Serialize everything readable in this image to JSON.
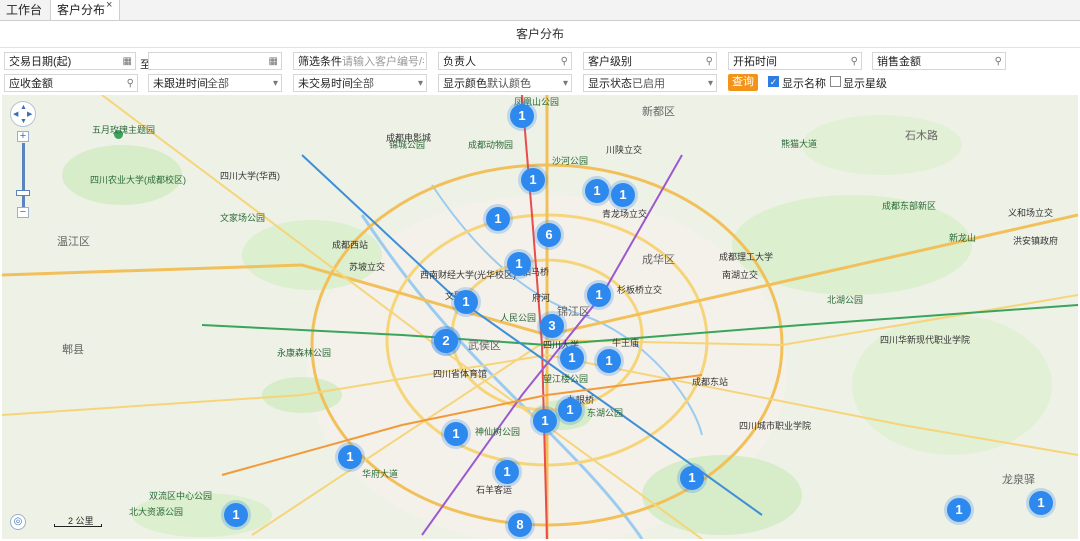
{
  "tabs": {
    "workbench": "工作台",
    "customer_dist": "客户分布",
    "close": "×"
  },
  "page_title": "客户分布",
  "filters": {
    "trade_date_start": "交易日期(起)",
    "to": "至",
    "screen_cond": "筛选条件",
    "screen_placeholder": "请输入客户编号/名",
    "owner": "负责人",
    "level": "客户级别",
    "open_time": "开拓时间",
    "sales_amount": "销售金额",
    "receivable": "应收金额",
    "no_follow_time": "未跟进时间",
    "no_follow_val": "全部",
    "no_trade_time": "未交易时间",
    "no_trade_val": "全部",
    "color_label": "显示颜色",
    "color_val": "默认颜色",
    "status_label": "显示状态",
    "status_val": "已启用",
    "query": "查询",
    "show_name": "显示名称",
    "show_star": "显示星级"
  },
  "map": {
    "scale": "2 公里",
    "markers": [
      "1",
      "1",
      "1",
      "1",
      "1",
      "1",
      "6",
      "1",
      "1",
      "1",
      "3",
      "2",
      "1",
      "1",
      "1",
      "1",
      "1",
      "1",
      "1",
      "1",
      "8",
      "1",
      "1"
    ],
    "districts": [
      "温江区",
      "锦江区",
      "武侯区",
      "成华区",
      "郫县",
      "新都区"
    ],
    "places": [
      "五月玫瑰主题园",
      "四川农业大学(成都校区)",
      "四川大学(华西)",
      "文家场公园",
      "成都西站",
      "苏坡立交",
      "西南财经大学(光华校区)",
      "人民公园",
      "四川大学",
      "永康森林公园",
      "四川省体育馆",
      "望江楼公园",
      "东湖公园",
      "神仙树公园",
      "四川城市职业学院",
      "成都东站",
      "华府大道",
      "北大资源公园",
      "双流区中心公园",
      "石羊客运",
      "锦城公园",
      "成都电影城",
      "凤凰山公园",
      "成都动物园",
      "熊猫大道",
      "石木路",
      "新龙山",
      "洪安镇政府",
      "成都理工大学",
      "南湖立交",
      "府河",
      "杉板桥立交",
      "青龙场立交",
      "沙河公园",
      "驷马桥",
      "牛王庙",
      "九眼桥",
      "龙泉驿",
      "川陕立交",
      "北湖公园",
      "四川华新现代职业学院",
      "义和场立交",
      "成都东部新区",
      "文殊院"
    ]
  }
}
